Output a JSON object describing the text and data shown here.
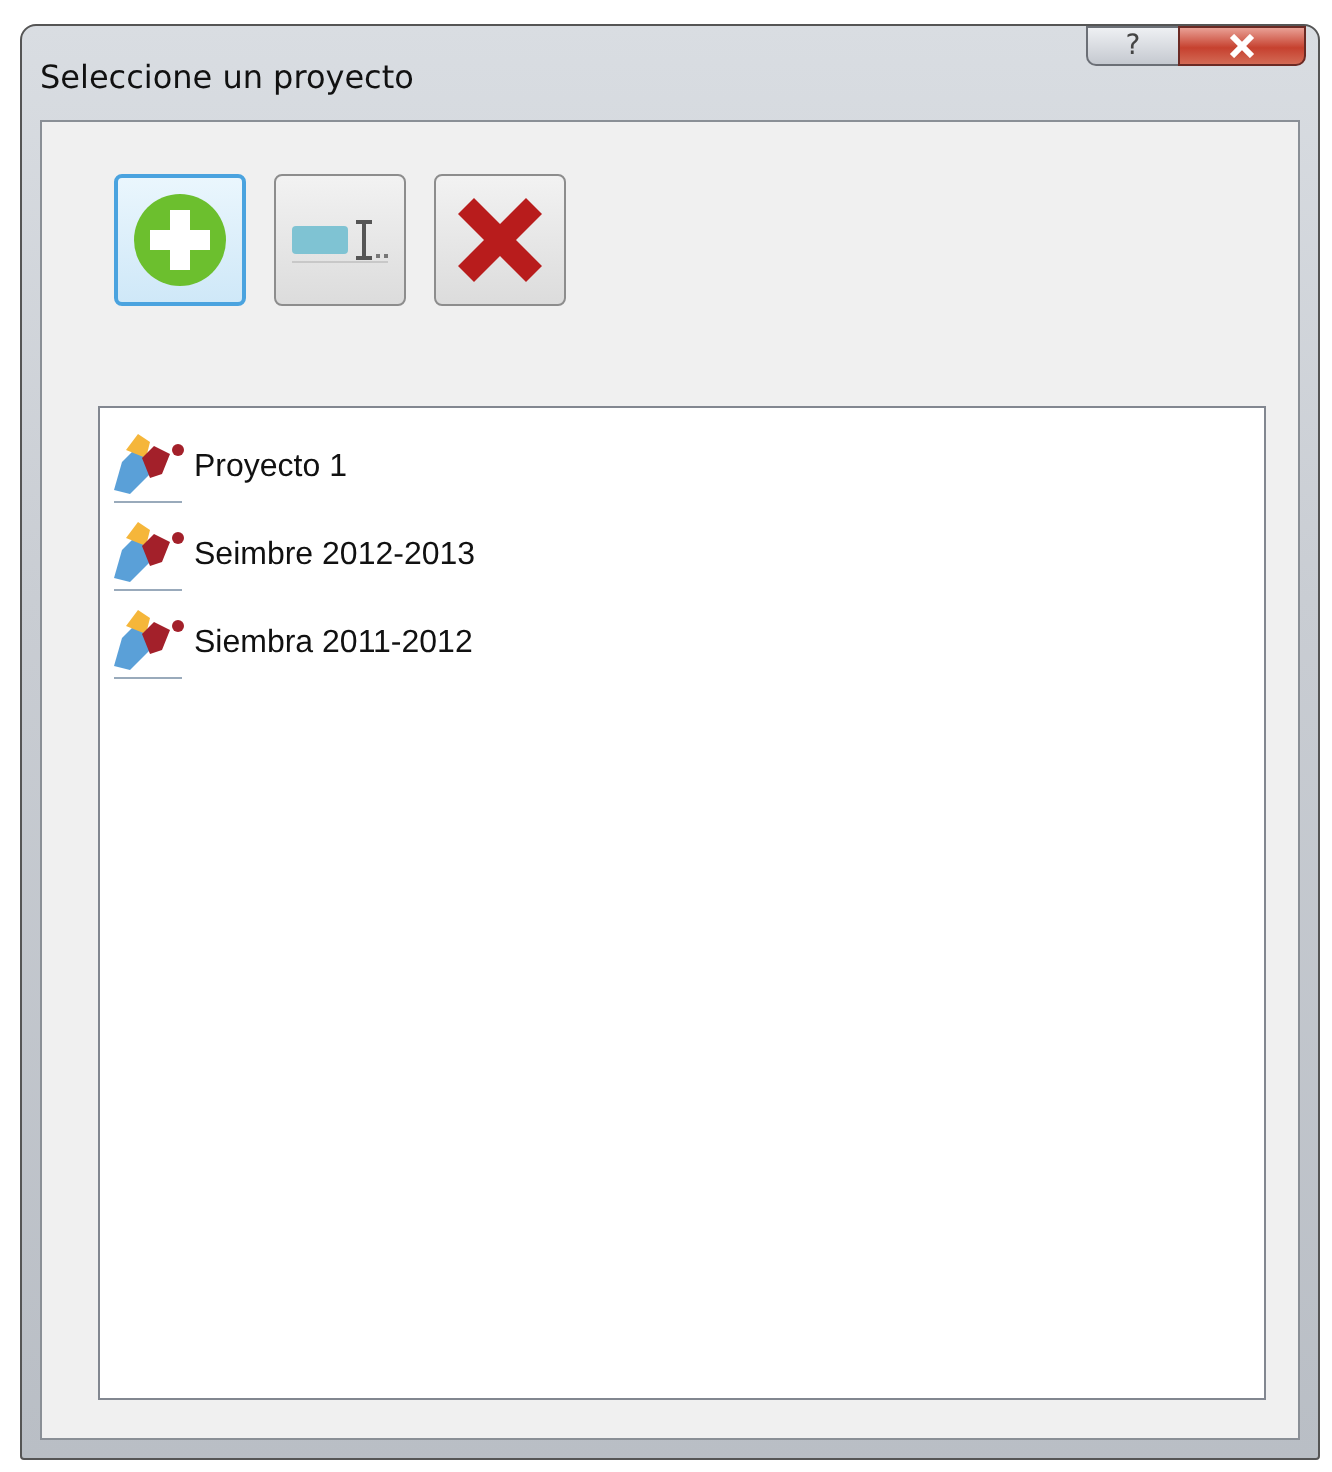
{
  "window": {
    "title": "Seleccione un proyecto",
    "help_button": "?"
  },
  "toolbar": [
    {
      "kind": "add",
      "selected": true
    },
    {
      "kind": "rename",
      "selected": false
    },
    {
      "kind": "delete",
      "selected": false
    }
  ],
  "projects": [
    {
      "name": "Proyecto 1"
    },
    {
      "name": "Seimbre 2012-2013"
    },
    {
      "name": "Siembra 2011-2012"
    }
  ]
}
